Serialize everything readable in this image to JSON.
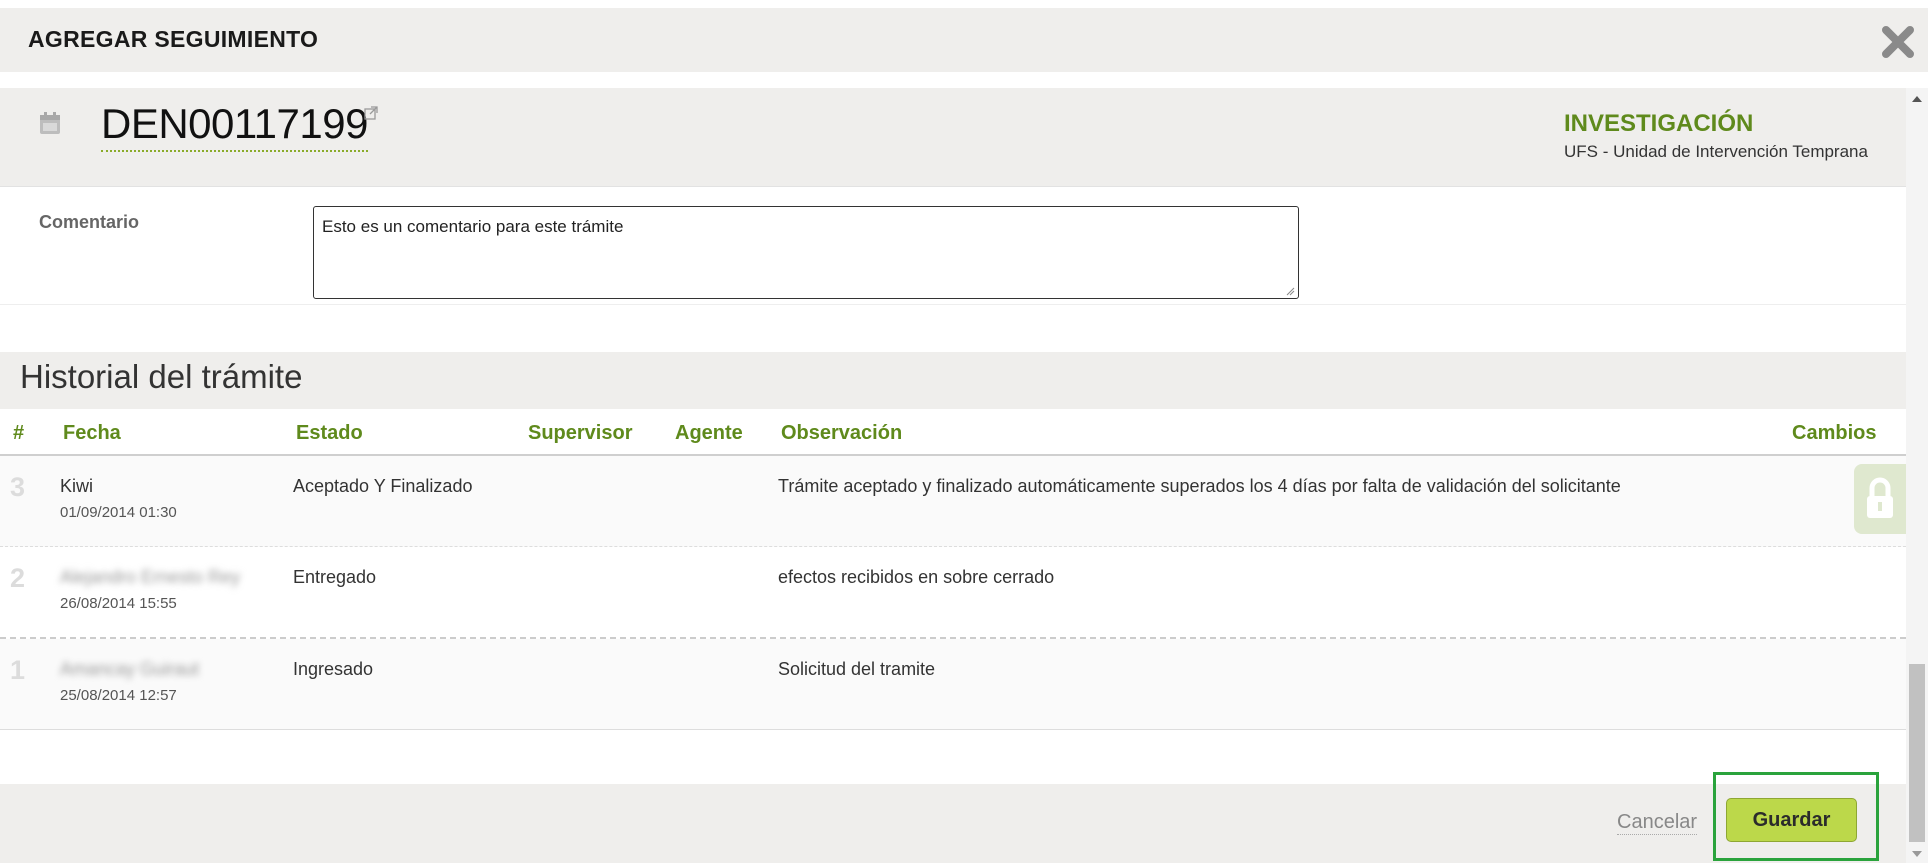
{
  "dialog": {
    "title": "AGREGAR SEGUIMIENTO"
  },
  "case": {
    "number": "DEN00117199",
    "status": "INVESTIGACIÓN",
    "unit": "UFS - Unidad de Intervención Temprana"
  },
  "comment": {
    "label": "Comentario",
    "value": "Esto es un comentario para este trámite"
  },
  "history": {
    "title": "Historial del trámite",
    "columns": {
      "num": "#",
      "fecha": "Fecha",
      "estado": "Estado",
      "supervisor": "Supervisor",
      "agente": "Agente",
      "observacion": "Observación",
      "cambios": "Cambios"
    },
    "rows": [
      {
        "num": "3",
        "name": "Kiwi",
        "date": "01/09/2014 01:30",
        "estado": "Aceptado Y Finalizado",
        "observacion": "Trámite aceptado y finalizado automáticamente superados los 4 días por falta de validación del solicitante"
      },
      {
        "num": "2",
        "name": "Alejandro Ernesto Rey",
        "date": "26/08/2014 15:55",
        "estado": "Entregado",
        "observacion": "efectos recibidos en sobre cerrado"
      },
      {
        "num": "1",
        "name": "Amancay Guiraut",
        "date": "25/08/2014 12:57",
        "estado": "Ingresado",
        "observacion": "Solicitud del tramite"
      }
    ]
  },
  "footer": {
    "cancel_label": "Cancelar",
    "save_label": "Guardar"
  },
  "colors": {
    "accent_green": "#5f8a1c",
    "save_button": "#bcd84a",
    "highlight": "#2aa33c"
  }
}
